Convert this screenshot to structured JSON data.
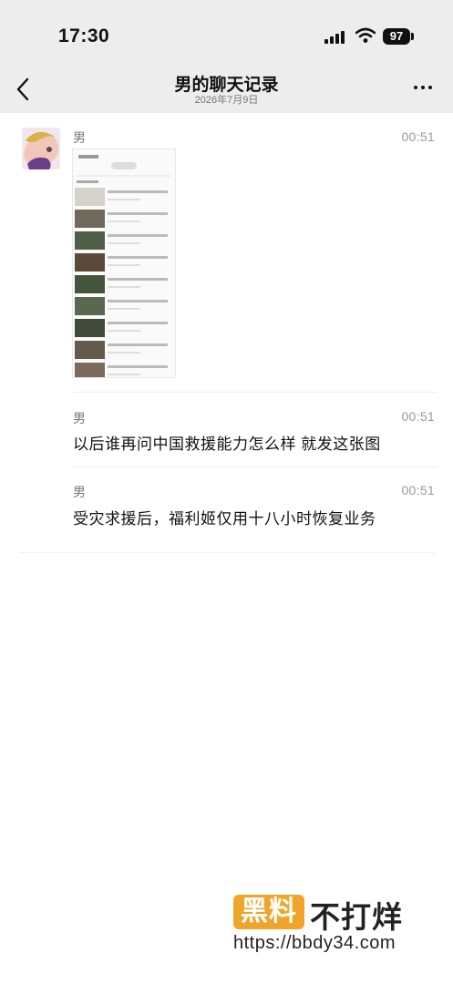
{
  "status_bar": {
    "time": "17:30",
    "battery": "97"
  },
  "header": {
    "title": "男的聊天记录",
    "subtitle": "2026年7月9日"
  },
  "messages": [
    {
      "sender": "男",
      "time": "00:51",
      "type": "image"
    },
    {
      "sender": "男",
      "time": "00:51",
      "text": "以后谁再问中国救援能力怎么样 就发这张图"
    },
    {
      "sender": "男",
      "time": "00:51",
      "text": "受灾求援后，福利姬仅用十八小时恢复业务"
    }
  ],
  "watermark": {
    "brand_box": "黑料",
    "brand_text": "不打烊",
    "url": "https://bbdy34.com"
  },
  "icons": [
    "back-chevron-icon",
    "more-dots-icon",
    "signal-icon",
    "wifi-icon",
    "battery-icon"
  ]
}
